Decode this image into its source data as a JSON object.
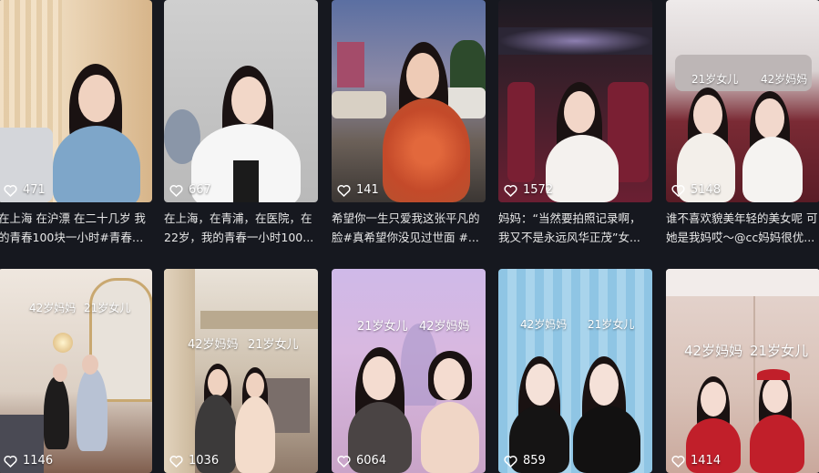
{
  "videos": [
    {
      "likes": "471",
      "caption": [
        "在上海 在沪漂 在二十几岁 我",
        "的青春100块一小时#青春的..."
      ],
      "tags": []
    },
    {
      "likes": "667",
      "caption": [
        "在上海，在青浦，在医院，在",
        "22岁，我的青春一小时100..."
      ],
      "tags": []
    },
    {
      "likes": "141",
      "caption": [
        "希望你一生只爱我这张平凡的",
        "脸#真希望你没见过世面 #..."
      ],
      "tags": []
    },
    {
      "likes": "1572",
      "caption": [
        "妈妈：“当然要拍照记录啊，",
        "我又不是永远风华正茂”女..."
      ],
      "tags": []
    },
    {
      "likes": "5148",
      "caption": [
        "谁不喜欢貌美年轻的美女呢 可",
        "她是我妈哎～@cc妈妈很优..."
      ],
      "tags": [
        "21岁女儿",
        "42岁妈妈"
      ]
    },
    {
      "likes": "1146",
      "caption": [],
      "tags": [
        "42岁妈妈",
        "21岁女儿"
      ]
    },
    {
      "likes": "1036",
      "caption": [],
      "tags": [
        "42岁妈妈",
        "21岁女儿"
      ]
    },
    {
      "likes": "6064",
      "caption": [],
      "tags": [
        "21岁女儿",
        "42岁妈妈"
      ]
    },
    {
      "likes": "859",
      "caption": [],
      "tags": [
        "42岁妈妈",
        "21岁女儿"
      ]
    },
    {
      "likes": "1414",
      "caption": [],
      "tags": [
        "42岁妈妈",
        "21岁女儿"
      ]
    }
  ],
  "icons": {
    "like": "heart-outline-icon"
  },
  "colors": {
    "background": "#16181f",
    "text": "#e8e8e8"
  }
}
